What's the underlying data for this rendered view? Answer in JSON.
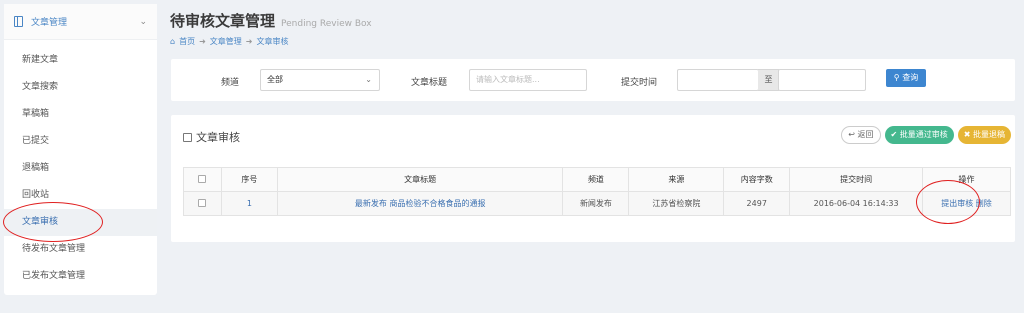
{
  "sidebar": {
    "header": "文章管理",
    "items": [
      "新建文章",
      "文章搜索",
      "草稿箱",
      "已提交",
      "退稿箱",
      "回收站",
      "文章审核",
      "待发布文章管理",
      "已发布文章管理"
    ],
    "active_index": 6
  },
  "header": {
    "title": "待审核文章管理",
    "subtitle": "Pending Review Box",
    "breadcrumb": [
      "首页",
      "文章管理",
      "文章审核"
    ]
  },
  "filter": {
    "channel_label": "频道",
    "channel_value": "全部",
    "title_label": "文章标题",
    "title_placeholder": "请输入文章标题...",
    "time_label": "提交时间",
    "date_separator": "至",
    "search_button": "查询"
  },
  "panel": {
    "title": "文章审核",
    "back_button": "返回",
    "approve_button": "批量通过审核",
    "reject_button": "批量退稿"
  },
  "table": {
    "columns": [
      "序号",
      "文章标题",
      "频道",
      "来源",
      "内容字数",
      "提交时间",
      "操作"
    ],
    "rows": [
      {
        "index": "1",
        "title": "最新发布 商品检验不合格食品的通报",
        "channel": "新闻发布",
        "source": "江苏省检察院",
        "words": "2497",
        "time": "2016-06-04 16:14:33",
        "actions": [
          "提出审核",
          "删除"
        ]
      }
    ]
  },
  "colors": {
    "accent": "#3d86d0",
    "approve": "#44b88e",
    "reject": "#e6b534",
    "annotation": "#e02020"
  }
}
